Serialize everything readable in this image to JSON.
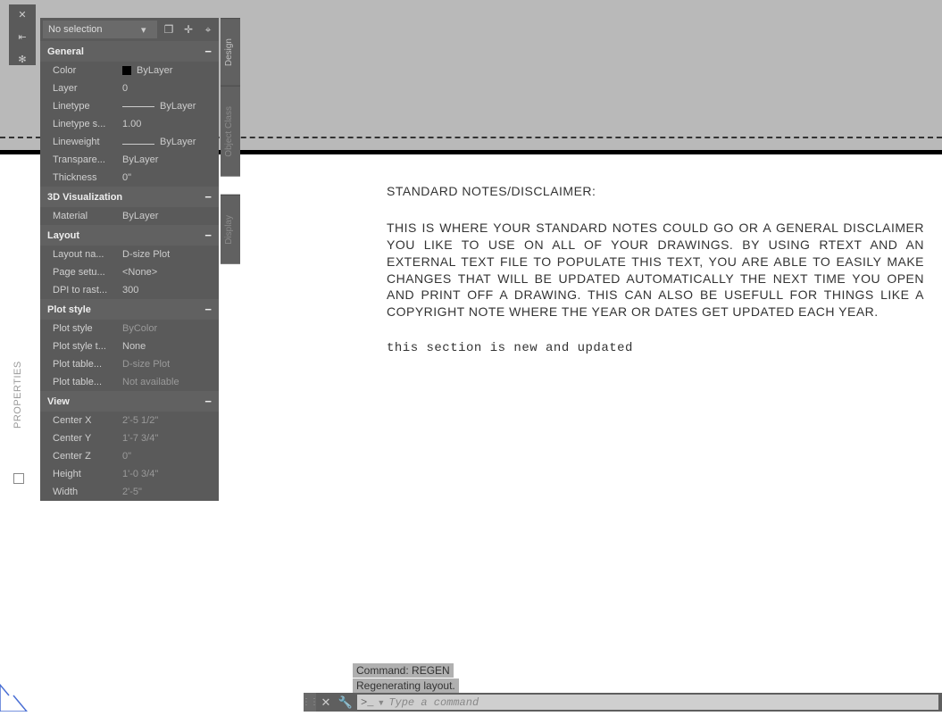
{
  "panel_title": "PROPERTIES",
  "selector": {
    "text": "No selection"
  },
  "side_tabs": [
    "Design",
    "Object Class",
    "Display"
  ],
  "sections": {
    "general": {
      "title": "General",
      "rows": [
        {
          "label": "Color",
          "value": "ByLayer",
          "swatch": true
        },
        {
          "label": "Layer",
          "value": "0"
        },
        {
          "label": "Linetype",
          "value": "ByLayer",
          "line": true
        },
        {
          "label": "Linetype s...",
          "value": "1.00"
        },
        {
          "label": "Lineweight",
          "value": "ByLayer",
          "lw": true
        },
        {
          "label": "Transpare...",
          "value": "ByLayer"
        },
        {
          "label": "Thickness",
          "value": "0\""
        }
      ]
    },
    "viz3d": {
      "title": "3D Visualization",
      "rows": [
        {
          "label": "Material",
          "value": "ByLayer"
        }
      ]
    },
    "layout": {
      "title": "Layout",
      "rows": [
        {
          "label": "Layout na...",
          "value": "D-size Plot"
        },
        {
          "label": "Page setu...",
          "value": "<None>"
        },
        {
          "label": "DPI to rast...",
          "value": "300"
        }
      ]
    },
    "plotstyle": {
      "title": "Plot style",
      "rows": [
        {
          "label": "Plot style",
          "value": "ByColor",
          "dim": true
        },
        {
          "label": "Plot style t...",
          "value": "None"
        },
        {
          "label": "Plot table...",
          "value": "D-size Plot",
          "dim": true
        },
        {
          "label": "Plot table...",
          "value": "Not available",
          "dim": true
        }
      ]
    },
    "view": {
      "title": "View",
      "rows": [
        {
          "label": "Center X",
          "value": "2'-5 1/2\"",
          "dim": true
        },
        {
          "label": "Center Y",
          "value": "1'-7 3/4\"",
          "dim": true
        },
        {
          "label": "Center Z",
          "value": "0\"",
          "dim": true
        },
        {
          "label": "Height",
          "value": "1'-0 3/4\"",
          "dim": true
        },
        {
          "label": "Width",
          "value": "2'-5\"",
          "dim": true
        }
      ]
    }
  },
  "drawing": {
    "title": "STANDARD NOTES/DISCLAIMER:",
    "body": "THIS IS WHERE YOUR STANDARD NOTES COULD GO OR A GENERAL DISCLAIMER YOU LIKE TO USE ON ALL OF YOUR DRAWINGS. BY USING RTEXT AND AN EXTERNAL TEXT FILE TO POPULATE THIS TEXT, YOU ARE ABLE TO EASILY MAKE CHANGES THAT WILL BE UPDATED AUTOMATICALLY THE NEXT TIME YOU OPEN AND PRINT OFF A DRAWING. THIS CAN ALSO BE USEFULL FOR THINGS LIKE A COPYRIGHT NOTE WHERE THE YEAR OR DATES GET UPDATED EACH YEAR.",
    "new": "this section is new and updated"
  },
  "cmd": {
    "hist1": "Command: REGEN",
    "hist2": "Regenerating layout.",
    "prompt": ">_",
    "placeholder": "Type a command"
  }
}
